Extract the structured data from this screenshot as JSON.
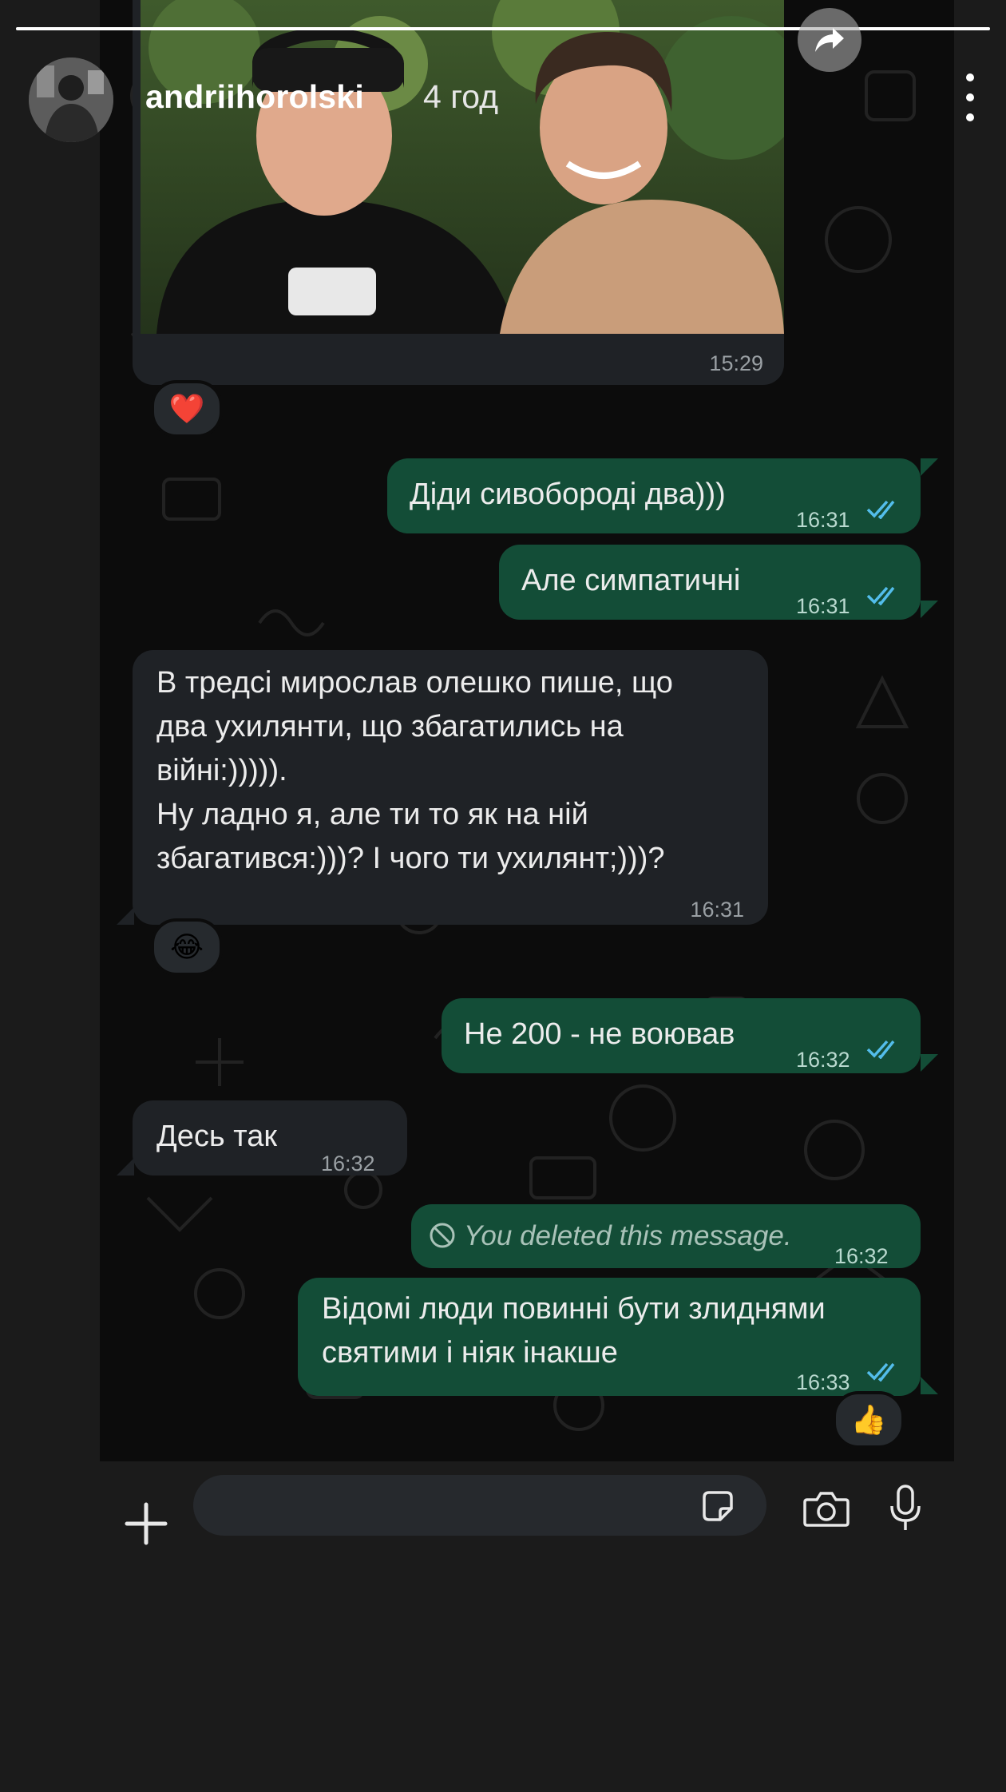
{
  "story": {
    "username": "andriihorolski",
    "age": "4 год",
    "progress": 1.0
  },
  "chat": {
    "photo_message": {
      "time": "15:29",
      "reaction": "❤️"
    },
    "messages": [
      {
        "dir": "out",
        "text": "Діди сивобороді два)))",
        "time": "16:31",
        "status": "read"
      },
      {
        "dir": "out",
        "text": "Але симпатичні",
        "time": "16:31",
        "status": "read"
      },
      {
        "dir": "in",
        "text": "В тредсі мирослав олешко пише, що\nдва ухилянти, що збагатились на\nвійні:))))).\nНу ладно я, але ти то як на ній\nзбагатився:)))? І чого ти ухилянт;)))?",
        "time": "16:31",
        "reaction": "😂"
      },
      {
        "dir": "out",
        "text": "Не 200 - не воював",
        "time": "16:32",
        "status": "read"
      },
      {
        "dir": "in",
        "text": "Десь так",
        "time": "16:32"
      },
      {
        "dir": "out",
        "text": "You deleted this message.",
        "time": "16:32",
        "deleted": true
      },
      {
        "dir": "out",
        "text": "Відомі люди повинні бути злиднями\nсвятими і ніяк інакше",
        "time": "16:33",
        "status": "read",
        "reaction": "👍"
      }
    ]
  },
  "input": {
    "placeholder": ""
  },
  "icons": {
    "share": "share-arrow-icon",
    "more": "more-vertical-icon",
    "plus": "plus-icon",
    "sticker": "sticker-icon",
    "camera": "camera-icon",
    "mic": "microphone-icon",
    "read": "double-check-icon",
    "deleted": "blocked-icon"
  },
  "colors": {
    "incoming_bubble": "#1f2226",
    "outgoing_bubble": "#134d37",
    "read_ticks": "#53bdeb",
    "background": "#0c0c0c"
  }
}
